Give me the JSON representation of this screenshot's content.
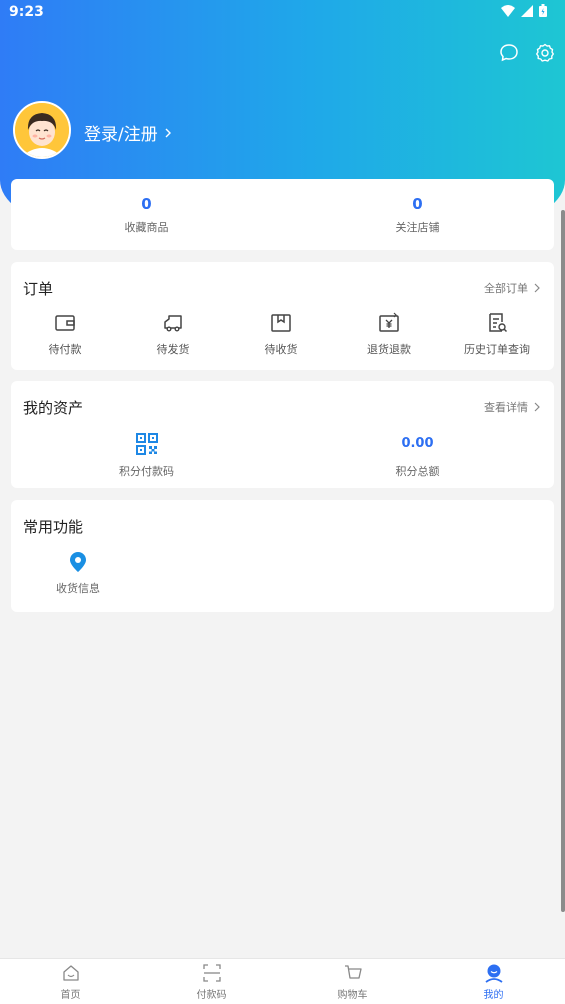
{
  "status_bar": {
    "time": "9:23"
  },
  "hero": {
    "login_label": "登录/注册"
  },
  "stats": [
    {
      "value": "0",
      "label": "收藏商品"
    },
    {
      "value": "0",
      "label": "关注店铺"
    }
  ],
  "orders": {
    "title": "订单",
    "link": "全部订单",
    "items": [
      {
        "label": "待付款",
        "icon": "wallet-icon"
      },
      {
        "label": "待发货",
        "icon": "truck-icon"
      },
      {
        "label": "待收货",
        "icon": "package-icon"
      },
      {
        "label": "退货退款",
        "icon": "refund-icon"
      },
      {
        "label": "历史订单查询",
        "icon": "order-search-icon"
      }
    ]
  },
  "assets": {
    "title": "我的资产",
    "link": "查看详情",
    "qr_label": "积分付款码",
    "points_value": "0.00",
    "points_label": "积分总额"
  },
  "common": {
    "title": "常用功能",
    "items": [
      {
        "label": "收货信息",
        "icon": "location-pin-icon"
      }
    ]
  },
  "tabs": [
    {
      "label": "首页",
      "icon": "home-icon"
    },
    {
      "label": "付款码",
      "icon": "scan-code-icon"
    },
    {
      "label": "购物车",
      "icon": "cart-icon"
    },
    {
      "label": "我的",
      "icon": "profile-icon",
      "active": true
    }
  ],
  "colors": {
    "accent": "#2d6ff2",
    "gradient_start": "#2f7cf6",
    "gradient_end": "#1ec6d3",
    "qr_blue": "#1e88e5",
    "pin_blue": "#1a8fe3"
  }
}
